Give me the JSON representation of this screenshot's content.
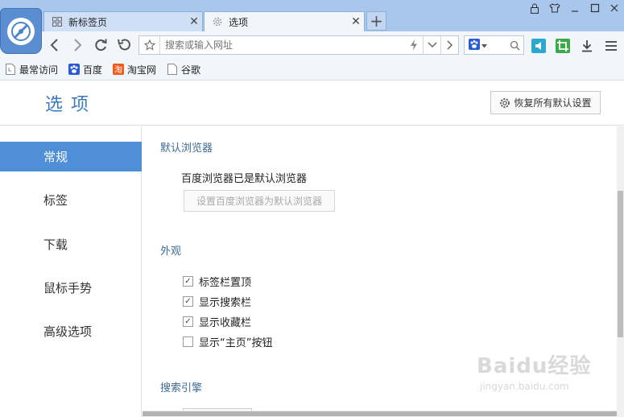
{
  "tabs": [
    {
      "label": "新标签页",
      "close": "✕"
    },
    {
      "label": "选项",
      "close": "✕"
    }
  ],
  "new_tab": "+",
  "address_bar": {
    "placeholder": "搜索或输入网址"
  },
  "bookmarks": [
    "最常访问",
    "百度",
    "淘宝网",
    "谷歌"
  ],
  "page": {
    "title": "选项",
    "restore_button": "恢复所有默认设置"
  },
  "sidebar": {
    "items": [
      {
        "label": "常规",
        "active": true
      },
      {
        "label": "标签",
        "active": false
      },
      {
        "label": "下载",
        "active": false
      },
      {
        "label": "鼠标手势",
        "active": false
      },
      {
        "label": "高级选项",
        "active": false
      }
    ]
  },
  "default_browser": {
    "section_title": "默认浏览器",
    "status": "百度浏览器已是默认浏览器",
    "button": "设置百度浏览器为默认浏览器"
  },
  "appearance": {
    "section_title": "外观",
    "options": [
      {
        "label": "标签栏置顶",
        "checked": true
      },
      {
        "label": "显示搜索栏",
        "checked": true
      },
      {
        "label": "显示收藏栏",
        "checked": true
      },
      {
        "label": "显示“主页”按钮",
        "checked": false
      }
    ]
  },
  "search_engine": {
    "section_title": "搜索引擎"
  },
  "watermark": {
    "text": "Baidu经验",
    "url": "jingyan.baidu.com"
  },
  "colors": {
    "accent": "#4e8fd8",
    "title": "#3b7abf",
    "titlebar": "#a9c6ed",
    "toolbar": "#f2f6fb"
  }
}
